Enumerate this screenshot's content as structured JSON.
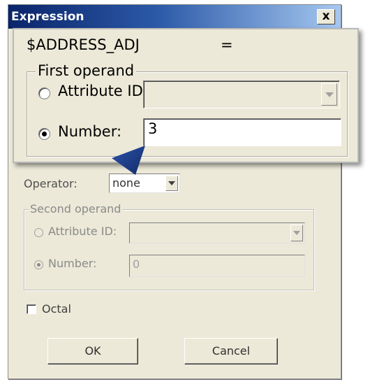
{
  "dialog": {
    "title": "Expression",
    "close_glyph": "x",
    "operator_label": "Operator:",
    "operator_value": "none",
    "second_operand": {
      "legend": "Second operand",
      "attribute_label": "Attribute ID:",
      "number_label": "Number:",
      "number_value": "0"
    },
    "octal_label": "Octal",
    "ok_label": "OK",
    "cancel_label": "Cancel"
  },
  "zoom": {
    "variable": "$ADDRESS_ADJ",
    "equals": "=",
    "first_operand": {
      "legend": "First operand",
      "attribute_label": "Attribute ID:",
      "number_label": "Number:",
      "number_value": "3",
      "selected": "number"
    }
  },
  "colors": {
    "titlebar_start": "#0a246a",
    "titlebar_end": "#a6c8f0",
    "dialog_bg": "#ece9d8",
    "callout_pointer": "#1f3d8a"
  }
}
